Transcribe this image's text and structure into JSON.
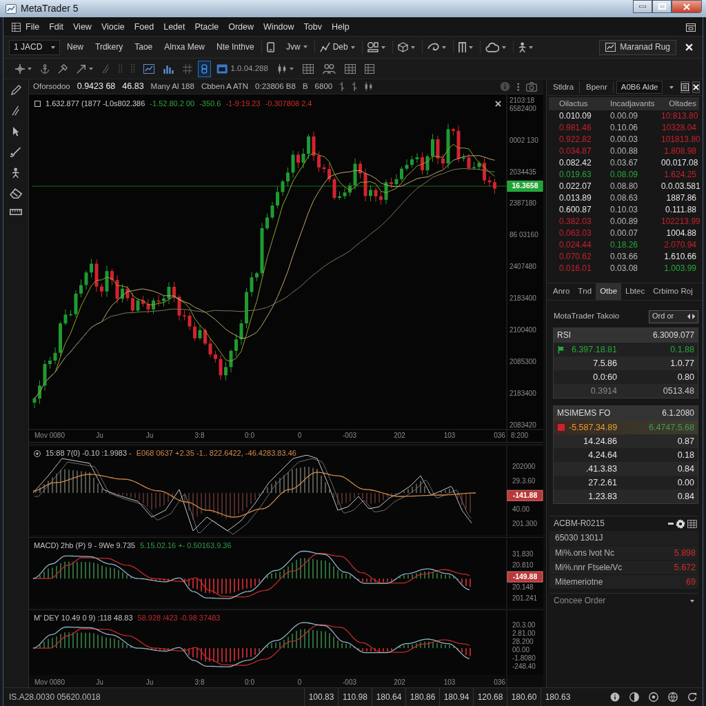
{
  "window": {
    "title": "MetaTrader 5"
  },
  "menu": {
    "items": [
      "File",
      "Fdit",
      "View",
      "Viocie",
      "Foed",
      "Ledet",
      "Ptacle",
      "Ordew",
      "Window",
      "Tobv",
      "Help"
    ]
  },
  "toolbar": {
    "items": [
      {
        "kind": "select",
        "label": "1 JACD"
      },
      {
        "kind": "text",
        "label": "New",
        "dropdown": false
      },
      {
        "kind": "text",
        "label": "Trdkery",
        "dropdown": false
      },
      {
        "kind": "text",
        "label": "Taoe",
        "dropdown": false
      },
      {
        "kind": "text",
        "label": "Alnxa Mew",
        "dropdown": false
      },
      {
        "kind": "text",
        "label": "Nte Inthve",
        "dropdown": false
      },
      {
        "kind": "icon",
        "dropdown": false
      },
      {
        "kind": "text",
        "label": "Jvw",
        "dropdown": true
      },
      {
        "kind": "icon",
        "label": "Deb",
        "dropdown": true
      },
      {
        "kind": "icon",
        "dropdown": true
      },
      {
        "kind": "icon",
        "dropdown": true
      },
      {
        "kind": "icon",
        "dropdown": true
      },
      {
        "kind": "icon",
        "dropdown": true
      },
      {
        "kind": "icon",
        "dropdown": true
      },
      {
        "kind": "icon",
        "dropdown": true
      }
    ],
    "account_button": "Maranad Rug"
  },
  "drawing_toolbar": {
    "tools": [
      {
        "dropdown": true,
        "selected": false
      },
      {
        "dropdown": false,
        "selected": false
      },
      {
        "dropdown": false,
        "selected": false
      },
      {
        "dropdown": true,
        "selected": false
      },
      {
        "dropdown": false,
        "selected": false
      },
      {
        "dropdown": false,
        "selected": false
      },
      {
        "dropdown": false,
        "selected": false
      },
      {
        "dropdown": false,
        "selected": false
      },
      {
        "dropdown": false,
        "selected": false
      },
      {
        "dropdown": false,
        "selected": false
      },
      {
        "dropdown": false,
        "selected": true
      },
      {
        "dropdown": false,
        "selected": false,
        "label": "1.0.04.288"
      },
      {
        "dropdown": true,
        "selected": false
      },
      {
        "dropdown": false,
        "selected": false
      },
      {
        "dropdown": false,
        "selected": false
      },
      {
        "dropdown": false,
        "selected": false
      },
      {
        "dropdown": false,
        "selected": false
      }
    ]
  },
  "chart_header": {
    "items": [
      {
        "text": "Oforsodoo",
        "bold": false
      },
      {
        "text": "0.9423 68",
        "bold": true
      },
      {
        "text": "46.83",
        "bold": true
      },
      {
        "text": "Many Al 188",
        "bold": false
      },
      {
        "text": "Cbben A ATN",
        "bold": false
      },
      {
        "text": "0:23806 B8",
        "bold": false
      },
      {
        "text": "B",
        "bold": false
      },
      {
        "text": "6800",
        "bold": false
      }
    ]
  },
  "main_chart": {
    "legend": [
      {
        "text": "1.632.877 (1877 -L0s802.386",
        "color": "#d0d0d0"
      },
      {
        "text": "-1.52.80.2 00",
        "color": "#2ea63e"
      },
      {
        "text": "-350.6",
        "color": "#2ea63e"
      },
      {
        "text": "-1-9:19.23",
        "color": "#d42a2a"
      },
      {
        "text": "-0.307808 2.4",
        "color": "#d42a2a"
      }
    ],
    "price_labels": [
      "2103:18",
      "6582400",
      "0002 130",
      "2034435",
      "2387180",
      "86 03160",
      "2407480",
      "2183400",
      "2100400",
      "2085300",
      "2183400",
      "2083420"
    ],
    "price_tag": "16.3658",
    "time_labels": [
      "Mov 0080",
      "Ju",
      "Ju",
      "3:8",
      "0:0",
      "0",
      "-003",
      "202",
      "103",
      "036"
    ],
    "corner_label": "8:200"
  },
  "indicators": [
    {
      "kind": "oscillator",
      "legend": [
        {
          "text": "15:88 7(0) -0.10 :1.9983 -",
          "color": "#c4c4c4"
        },
        {
          "text": "E068 0637 +2.35 -1.. 822.6422, -46.4283.83.46",
          "color": "#d4894a"
        }
      ],
      "price_labels": [
        "202000",
        "29.3.60",
        "40.00",
        "201.300"
      ],
      "value_tag": "-141.88"
    },
    {
      "kind": "macd",
      "legend": [
        {
          "text": "MACD) 2hb (P) 9 - 9We 9.735",
          "color": "#c4c4c4"
        },
        {
          "text": "5.15.02.16 +- 0.50163.9.36",
          "color": "#2e9a4a"
        }
      ],
      "price_labels": [
        "31.830",
        "20.810",
        "20.148",
        "201.241"
      ],
      "value_tag": "-149.88"
    },
    {
      "kind": "macd",
      "legend": [
        {
          "text": "M' DEY 10.49 0 9) :118 48.83",
          "color": "#c4c4c4"
        },
        {
          "text": "58.928 /423 -0.98 37483",
          "color": "#c42a2a"
        }
      ],
      "price_labels": [
        "20.3.00",
        "2.81.00",
        "28.200",
        "00.00",
        "-1.8080",
        "-248.40"
      ]
    }
  ],
  "bottom_axis": {
    "time_labels": [
      "Mov 0080",
      "Ju",
      "Ju",
      "3:8",
      "0:0",
      "0",
      "-003",
      "202",
      "103",
      "036"
    ]
  },
  "side_panel": {
    "tabs": [
      "Stldra",
      "Bpenr"
    ],
    "symbol": "A0B6 Alde",
    "table": {
      "columns": [
        "Oilactus",
        "Incadjavants",
        "Oltades"
      ],
      "rows": [
        [
          {
            "text": "0.010.09",
            "color": "#e6e6e6"
          },
          {
            "text": "0.00.09",
            "color": "#b8b8b8"
          },
          {
            "text": "10:813.80",
            "color": "#c8202c"
          }
        ],
        [
          {
            "text": "0.981.46",
            "color": "#c8202c"
          },
          {
            "text": "0.10.06",
            "color": "#b8b8b8"
          },
          {
            "text": "10328.04",
            "color": "#c8202c"
          }
        ],
        [
          {
            "text": "0.922.82",
            "color": "#c8202c"
          },
          {
            "text": "0.00.03",
            "color": "#b8b8b8"
          },
          {
            "text": "101813.80",
            "color": "#c8202c"
          }
        ],
        [
          {
            "text": "0.034.87",
            "color": "#c8202c"
          },
          {
            "text": "0.00.88",
            "color": "#b8b8b8"
          },
          {
            "text": "1.808.98",
            "color": "#c8202c"
          }
        ],
        [
          {
            "text": "0.082.42",
            "color": "#e6e6e6"
          },
          {
            "text": "0.03.67",
            "color": "#b8b8b8"
          },
          {
            "text": "00.017.08",
            "color": "#e6e6e6"
          }
        ],
        [
          {
            "text": "0.019.63",
            "color": "#24a83a"
          },
          {
            "text": "0.08.09",
            "color": "#24a83a"
          },
          {
            "text": "1.624.25",
            "color": "#c8202c"
          }
        ],
        [
          {
            "text": "0.022.07",
            "color": "#e6e6e6"
          },
          {
            "text": "0.08.80",
            "color": "#b8b8b8"
          },
          {
            "text": "0.0.03.581",
            "color": "#e6e6e6"
          }
        ],
        [
          {
            "text": "0.013.89",
            "color": "#e6e6e6"
          },
          {
            "text": "0.08.63",
            "color": "#b8b8b8"
          },
          {
            "text": "1887.86",
            "color": "#e6e6e6"
          }
        ],
        [
          {
            "text": "0.600.87",
            "color": "#e6e6e6"
          },
          {
            "text": "0.10.03",
            "color": "#b8b8b8"
          },
          {
            "text": "0.111.88",
            "color": "#e6e6e6"
          }
        ],
        [
          {
            "text": "0.382.03",
            "color": "#c8202c"
          },
          {
            "text": "0.00.89",
            "color": "#b8b8b8"
          },
          {
            "text": "102213.99",
            "color": "#c8202c"
          }
        ],
        [
          {
            "text": "0.063.03",
            "color": "#c8202c"
          },
          {
            "text": "0.00.07",
            "color": "#b8b8b8"
          },
          {
            "text": "1004.88",
            "color": "#e6e6e6"
          }
        ],
        [
          {
            "text": "0.024.44",
            "color": "#c8202c"
          },
          {
            "text": "0.18.26",
            "color": "#24a83a"
          },
          {
            "text": "2.070.94",
            "color": "#c8202c"
          }
        ],
        [
          {
            "text": "0.070.62",
            "color": "#c8202c"
          },
          {
            "text": "0.03.66",
            "color": "#b8b8b8"
          },
          {
            "text": "1.610.66",
            "color": "#e6e6e6"
          }
        ],
        [
          {
            "text": "0.016.01",
            "color": "#c8202c"
          },
          {
            "text": "0.03.08",
            "color": "#b8b8b8"
          },
          {
            "text": "1.003.99",
            "color": "#24a83a"
          }
        ]
      ]
    },
    "lower_tabs": [
      {
        "label": "Anro",
        "selected": false
      },
      {
        "label": "Tnd",
        "selected": false
      },
      {
        "label": "Otbe",
        "selected": true
      },
      {
        "label": "Lbtec",
        "selected": false
      },
      {
        "label": "Crbimo Roj",
        "selected": false
      }
    ],
    "indicator_title": "MotaTrader Takoio",
    "order_button": "Ord or",
    "groups": [
      {
        "title": "RSI",
        "value": "6.3009.077",
        "rows": [
          {
            "kind": "flag",
            "cells": [
              {
                "text": "6.397.18.81",
                "color": "#24a83a"
              },
              {
                "text": "0.1.88",
                "color": "#24a83a"
              }
            ]
          },
          {
            "kind": "plain",
            "cells": [
              {
                "text": "7.5.86",
                "color": "#e6e6e6"
              },
              {
                "text": "1.0.77",
                "color": "#e6e6e6"
              }
            ]
          },
          {
            "kind": "plain",
            "cells": [
              {
                "text": "0.0:60",
                "color": "#e6e6e6"
              },
              {
                "text": "0.80",
                "color": "#e6e6e6"
              }
            ]
          },
          {
            "kind": "plain",
            "cells": [
              {
                "text": "0.3914",
                "color": "#8a8a8a"
              },
              {
                "text": "0513.48",
                "color": "#c8c8c8"
              }
            ]
          }
        ]
      },
      {
        "title": "MSIMEMS FO",
        "value": "6.1.2080",
        "rows": [
          {
            "kind": "alert",
            "cells": [
              {
                "text": "-5.587.34.89",
                "color": "#e0a030"
              },
              {
                "text": "6.4747.5.68",
                "color": "#3aa04a"
              }
            ]
          },
          {
            "kind": "plain",
            "cells": [
              {
                "text": "14.24.86",
                "color": "#e6e6e6"
              },
              {
                "text": "0.87",
                "color": "#e6e6e6"
              }
            ]
          },
          {
            "kind": "plain",
            "cells": [
              {
                "text": "4.24.64",
                "color": "#e6e6e6"
              },
              {
                "text": "0.18",
                "color": "#e6e6e6"
              }
            ]
          },
          {
            "kind": "plain",
            "cells": [
              {
                "text": ".41.3.83",
                "color": "#e6e6e6"
              },
              {
                "text": "0.84",
                "color": "#e6e6e6"
              }
            ]
          },
          {
            "kind": "plain",
            "cells": [
              {
                "text": "27.2.61",
                "color": "#e6e6e6"
              },
              {
                "text": "0.00",
                "color": "#e6e6e6"
              }
            ]
          },
          {
            "kind": "plain",
            "cells": [
              {
                "text": "1.23.83",
                "color": "#e6e6e6"
              },
              {
                "text": "0.84",
                "color": "#e6e6e6"
              }
            ]
          }
        ]
      }
    ],
    "account": {
      "title": "ACBM-R0215",
      "subtitle": "65030 1301J",
      "rows": [
        {
          "label": "Mi%.ons lvot Nc",
          "value": "5.898"
        },
        {
          "label": "Mi%.nnr Ftsele/Vc",
          "value": "5.672"
        },
        {
          "label": "Mitemeriotne",
          "value": "69"
        }
      ]
    },
    "order_section": "Concee Order"
  },
  "status_bar": {
    "text": "IS.A28.0030 05620.0018",
    "cells": [
      "100.83",
      "110.98",
      "180.64",
      "180.86",
      "180.94",
      "120.68",
      "180.60",
      "180.63"
    ]
  }
}
